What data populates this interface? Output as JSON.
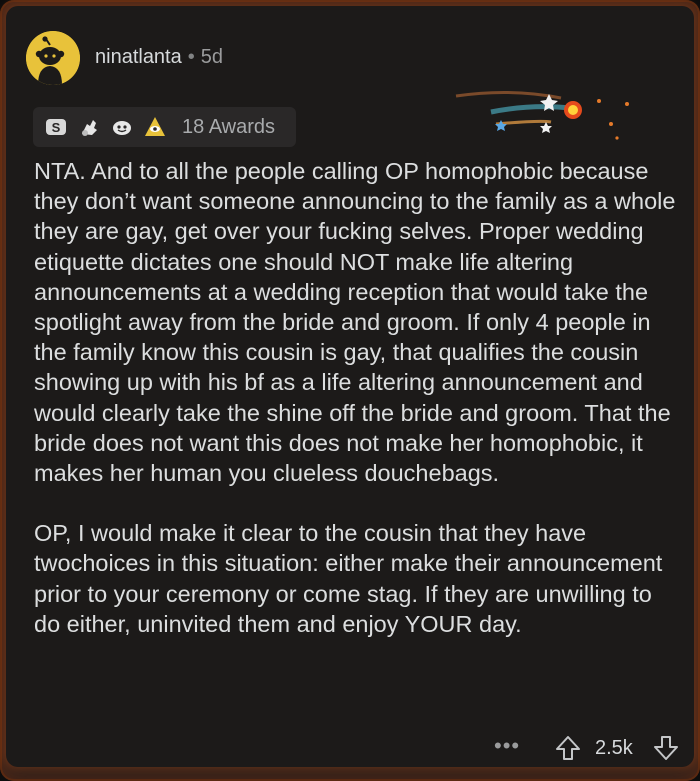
{
  "comment": {
    "username": "ninatlanta",
    "separator": "•",
    "age": "5d",
    "awards_label": "18 Awards",
    "award_icons": [
      "silver-award-icon",
      "helpful-hand-icon",
      "wholesome-face-icon",
      "all-seeing-upvote-icon"
    ],
    "paragraphs": [
      "NTA. And to all the people calling OP homophobic because they don’t want someone announcing to the family as a whole they are gay, get over your fucking selves.  Proper wedding etiquette dictates one should NOT make life altering announcements at a wedding reception that would take the spotlight away from the bride and groom. If only 4 people in the family know this cousin is gay, that qualifies the cousin showing up with his bf as a life altering announcement and would clearly take the shine off the bride and groom.  That the bride does not want this does not make her homophobic, it makes her human you clueless douchebags.",
      "OP, I would make it clear to the cousin that they have twochoices in this situation: either make their announcement prior to your ceremony or come stag.  If they are unwilling to do either, uninvited them and enjoy YOUR day."
    ],
    "more_label": "•••",
    "score": "2.5k"
  },
  "colors": {
    "avatar": "#e8c23a",
    "glow": "#be5019",
    "background": "#1c1a19"
  }
}
